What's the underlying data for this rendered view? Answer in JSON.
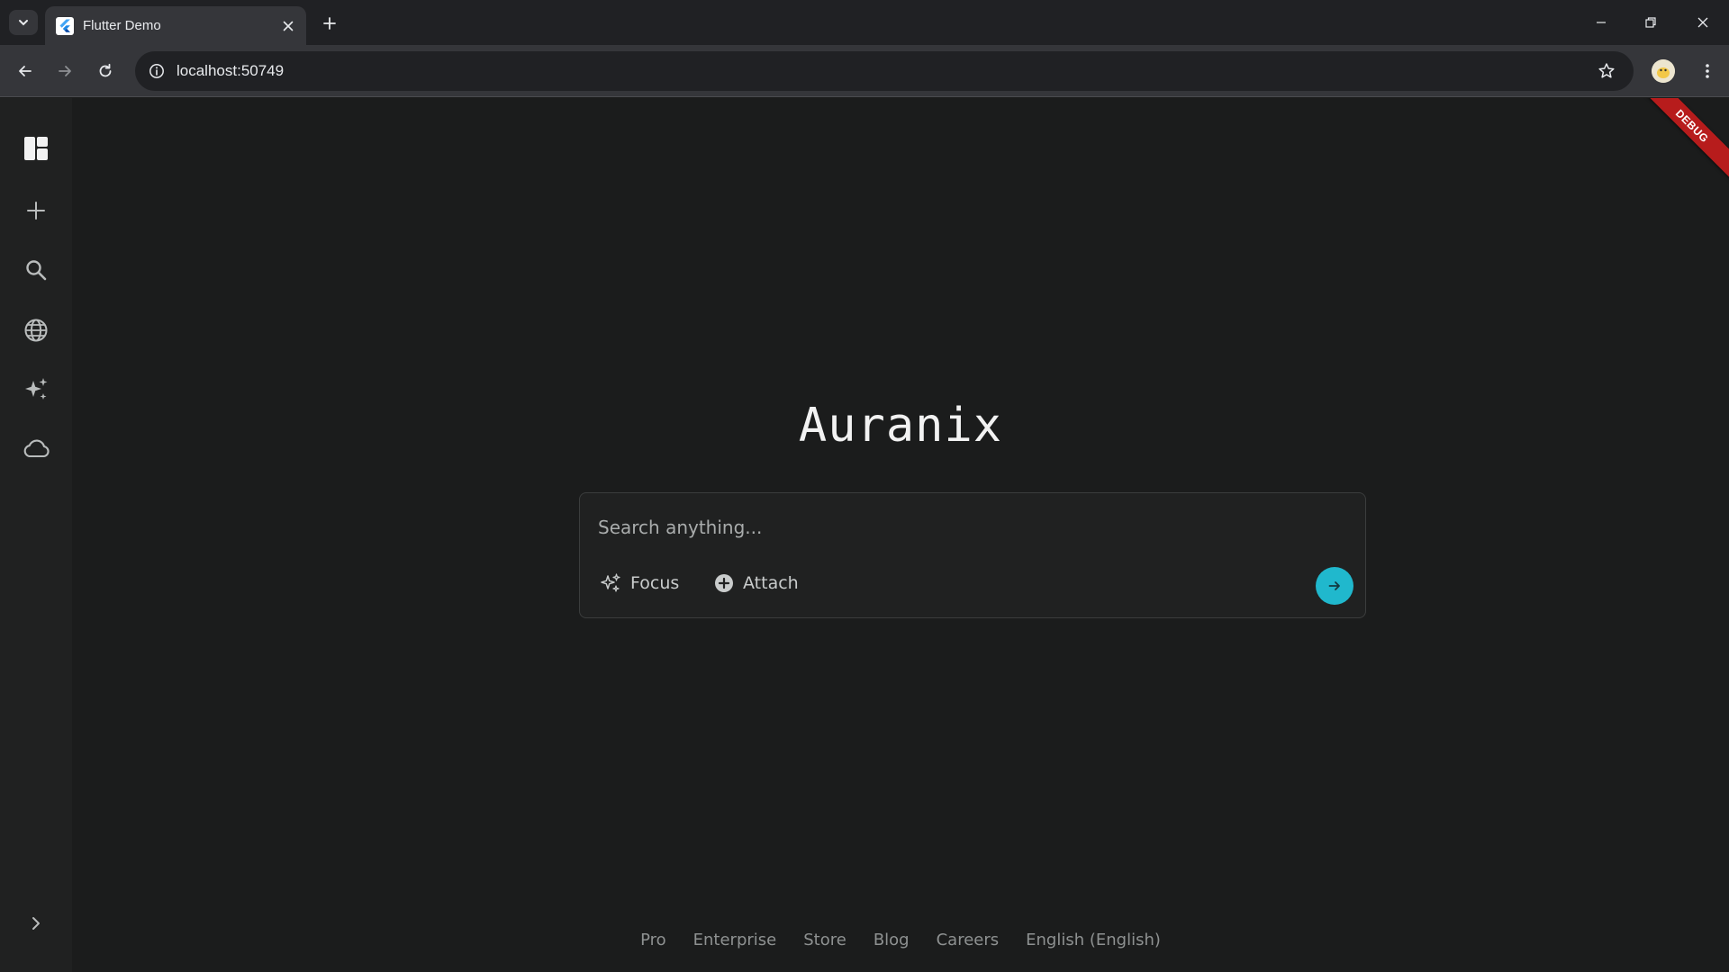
{
  "browser": {
    "tab_title": "Flutter Demo",
    "url": "localhost:50749"
  },
  "app": {
    "brand": "Auranix",
    "debug_label": "DEBUG",
    "search": {
      "placeholder": "Search anything...",
      "focus_label": "Focus",
      "attach_label": "Attach"
    },
    "sidebar": {
      "items": [
        {
          "icon": "layout-grid-icon"
        },
        {
          "icon": "plus-icon"
        },
        {
          "icon": "search-icon"
        },
        {
          "icon": "globe-icon"
        },
        {
          "icon": "sparkles-icon"
        },
        {
          "icon": "cloud-icon"
        }
      ],
      "expand_icon": "chevron-right-icon"
    },
    "footer": {
      "links": [
        "Pro",
        "Enterprise",
        "Store",
        "Blog",
        "Careers",
        "English (English)"
      ]
    },
    "colors": {
      "accent": "#20b8cd",
      "background": "#1b1c1c",
      "sidebar": "#202121",
      "debug_banner": "#b71c1c"
    }
  }
}
